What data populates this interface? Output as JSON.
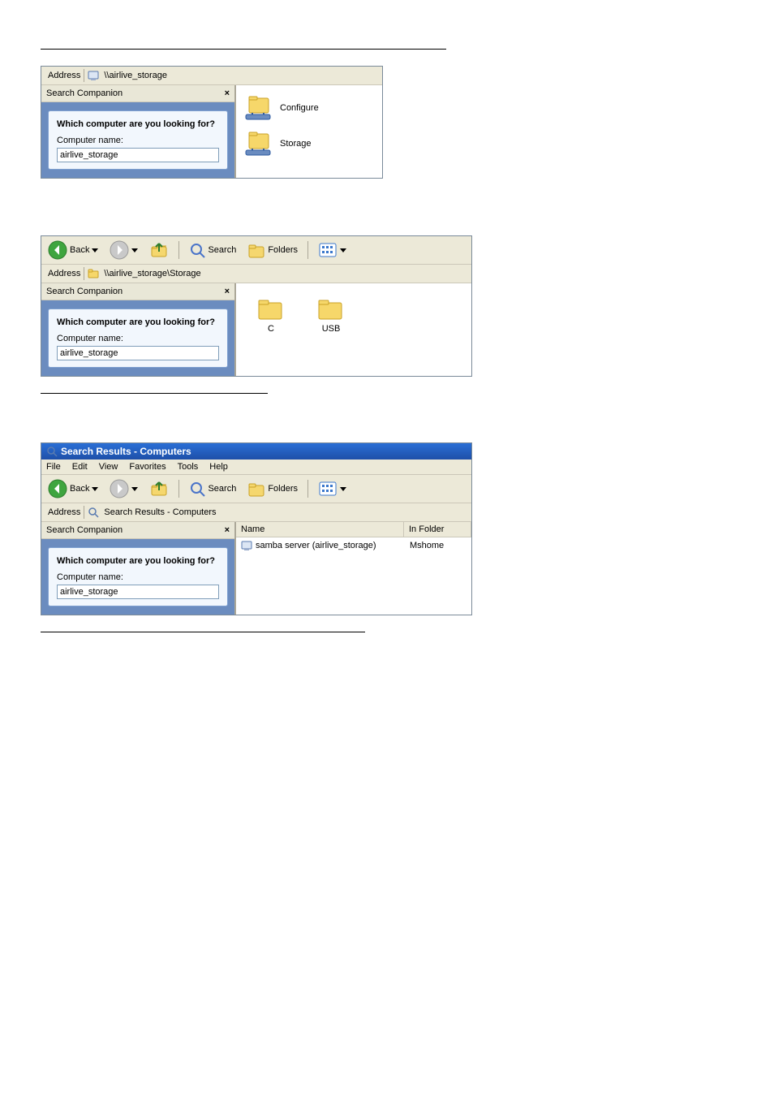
{
  "screen1": {
    "address_label": "Address",
    "address_value": "\\\\airlive_storage",
    "sidebar": {
      "title": "Search Companion",
      "question": "Which computer are you looking for?",
      "cn_label": "Computer name:",
      "cn_value": "airlive_storage"
    },
    "shares": [
      {
        "label": "Configure"
      },
      {
        "label": "Storage"
      }
    ]
  },
  "screen2": {
    "toolbar": {
      "back": "Back",
      "search": "Search",
      "folders": "Folders"
    },
    "address_label": "Address",
    "address_value": "\\\\airlive_storage\\Storage",
    "sidebar": {
      "title": "Search Companion",
      "question": "Which computer are you looking for?",
      "cn_label": "Computer name:",
      "cn_value": "airlive_storage"
    },
    "folders": [
      {
        "label": "C"
      },
      {
        "label": "USB"
      }
    ]
  },
  "screen3": {
    "title": "Search Results - Computers",
    "menu": [
      "File",
      "Edit",
      "View",
      "Favorites",
      "Tools",
      "Help"
    ],
    "toolbar": {
      "back": "Back",
      "search": "Search",
      "folders": "Folders"
    },
    "address_label": "Address",
    "address_value": "Search Results - Computers",
    "sidebar": {
      "title": "Search Companion",
      "question": "Which computer are you looking for?",
      "cn_label": "Computer name:",
      "cn_value": "airlive_storage"
    },
    "columns": {
      "name": "Name",
      "in_folder": "In Folder"
    },
    "results": [
      {
        "name": "samba server (airlive_storage)",
        "in_folder": "Mshome"
      }
    ]
  }
}
